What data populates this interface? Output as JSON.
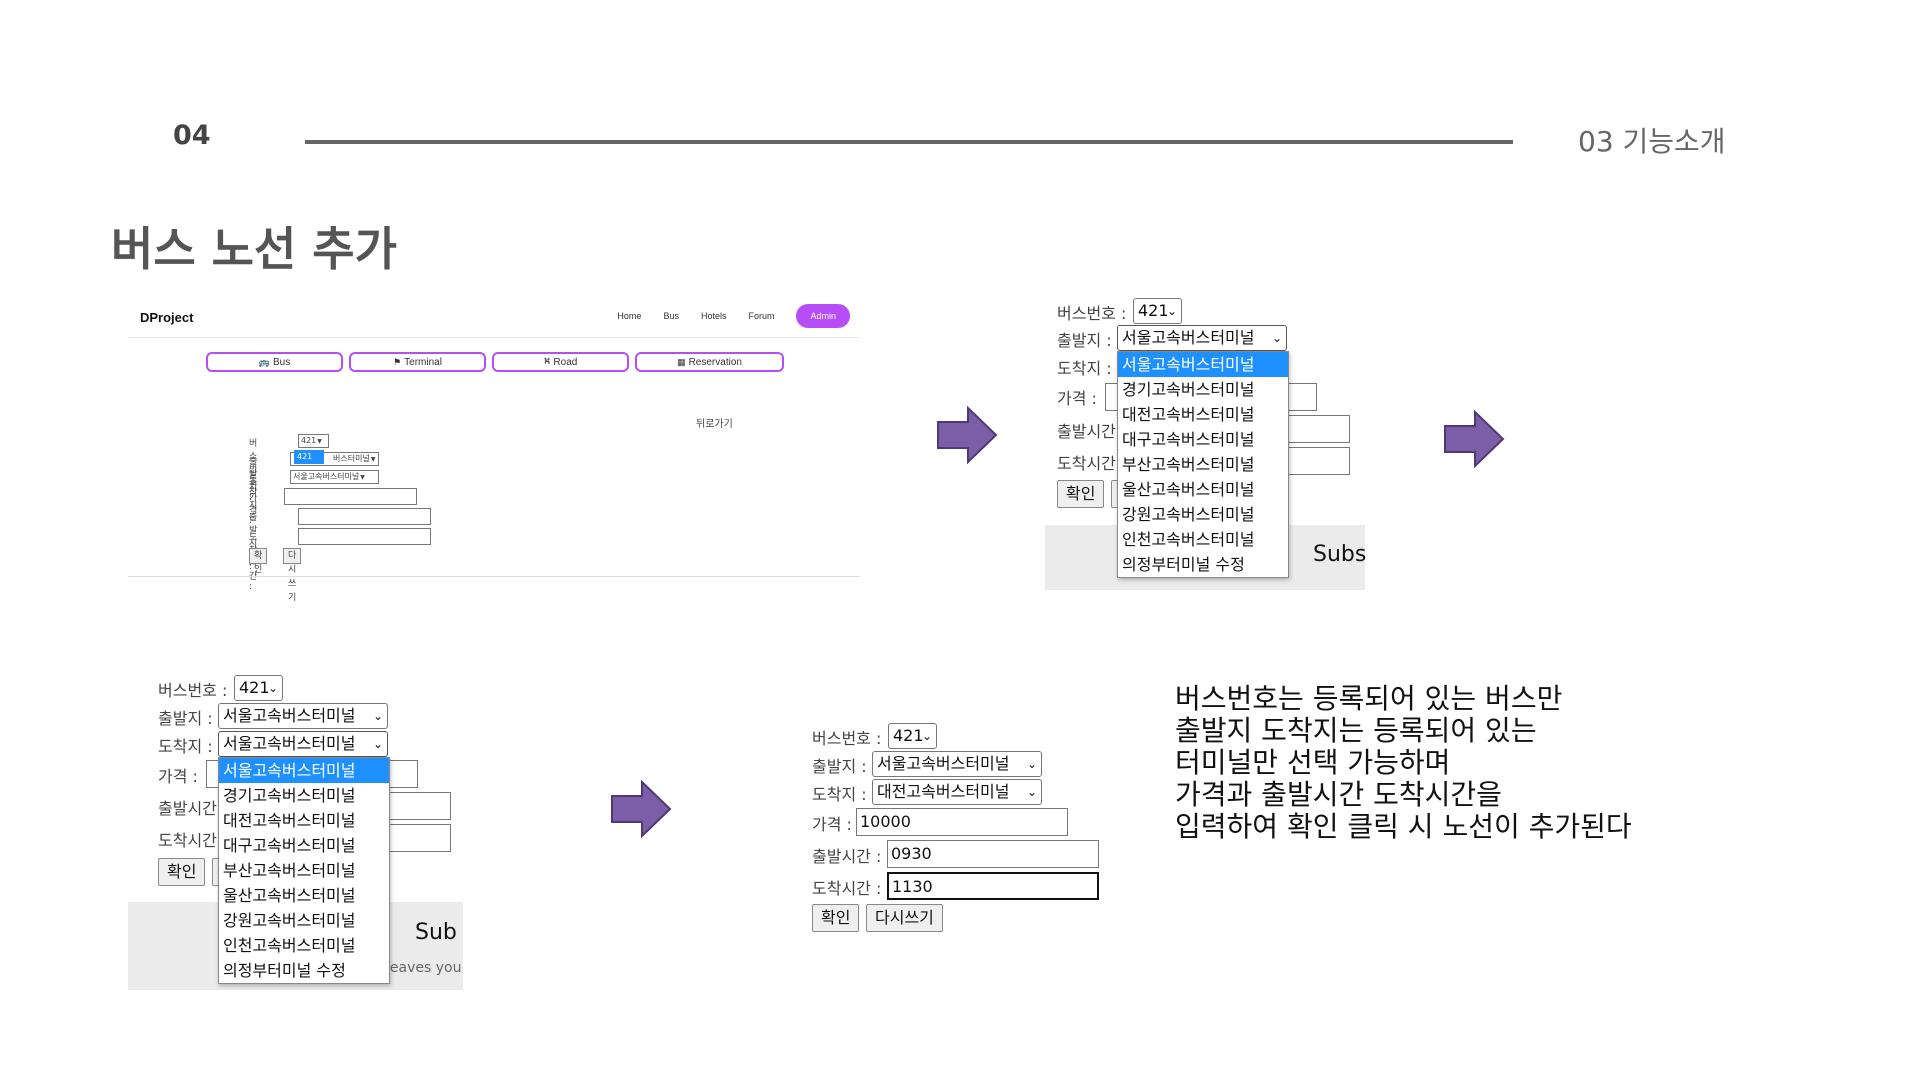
{
  "slide": {
    "page_number": "04",
    "section": "03 기능소개",
    "title": "버스 노선 추가",
    "description": [
      "버스번호는 등록되어 있는 버스만",
      "출발지 도착지는 등록되어 있는",
      "터미널만 선택 가능하며",
      "가격과 출발시간 도착시간을",
      "입력하여 확인 클릭 시 노선이 추가된다"
    ]
  },
  "shot1": {
    "brand": "DProject",
    "nav": [
      "Home",
      "Bus",
      "Hotels",
      "Forum"
    ],
    "nav_active": "Admin",
    "tabs": [
      {
        "icon": "bus-icon",
        "glyph": "🚌",
        "label": "Bus"
      },
      {
        "icon": "signpost-icon",
        "glyph": "⚑",
        "label": "Terminal"
      },
      {
        "icon": "road-icon",
        "glyph": "⛕",
        "label": "Road"
      },
      {
        "icon": "calendar-icon",
        "glyph": "▦",
        "label": "Reservation"
      }
    ],
    "back_link": "뒤로가기",
    "labels": {
      "bus": "버스번호 :",
      "from": "출발지 :",
      "to": "도착지 :",
      "price": "가격 :",
      "depart": "출발시간 :",
      "arrive": "도착시간 :"
    },
    "bus_value": "421",
    "bus_popup": "421",
    "from_value": "버스터미널",
    "to_value": "서울고속버스터미널",
    "confirm": "확인",
    "reset": "다시쓰기"
  },
  "shot2": {
    "labels": {
      "bus": "버스번호 :",
      "from": "출발지 :",
      "to": "도착지 :",
      "price": "가격 :",
      "depart": "출발시간 :",
      "arrive": "도착시간 :"
    },
    "bus_value": "421",
    "from_value": "서울고속버스터미널",
    "confirm": "확인",
    "partial_text": "Subs",
    "options": [
      "서울고속버스터미널",
      "경기고속버스터미널",
      "대전고속버스터미널",
      "대구고속버스터미널",
      "부산고속버스터미널",
      "울산고속버스터미널",
      "강원고속버스터미널",
      "인천고속버스터미널",
      "의정부터미널 수정"
    ],
    "active_option": 0
  },
  "shot3": {
    "labels": {
      "bus": "버스번호 :",
      "from": "출발지 :",
      "to": "도착지 :",
      "price": "가격 :",
      "depart": "출발시간 :",
      "arrive": "도착시간 :"
    },
    "bus_value": "421",
    "from_value": "서울고속버스터미널",
    "to_value": "서울고속버스터미널",
    "confirm": "확인",
    "partial_text": "Sub",
    "partial_text2": "leaves you",
    "options": [
      "서울고속버스터미널",
      "경기고속버스터미널",
      "대전고속버스터미널",
      "대구고속버스터미널",
      "부산고속버스터미널",
      "울산고속버스터미널",
      "강원고속버스터미널",
      "인천고속버스터미널",
      "의정부터미널 수정"
    ],
    "active_option": 0
  },
  "shot4": {
    "labels": {
      "bus": "버스번호 :",
      "from": "출발지 :",
      "to": "도착지 :",
      "price": "가격 :",
      "depart": "출발시간 :",
      "arrive": "도착시간 :"
    },
    "bus_value": "421",
    "from_value": "서울고속버스터미널",
    "to_value": "대전고속버스터미널",
    "price_value": "10000",
    "depart_value": "0930",
    "arrive_value": "1130",
    "confirm": "확인",
    "reset": "다시쓰기"
  },
  "colors": {
    "accent": "#b64df7",
    "arrow": "#7b5ea7",
    "selected": "#1e90ff"
  }
}
